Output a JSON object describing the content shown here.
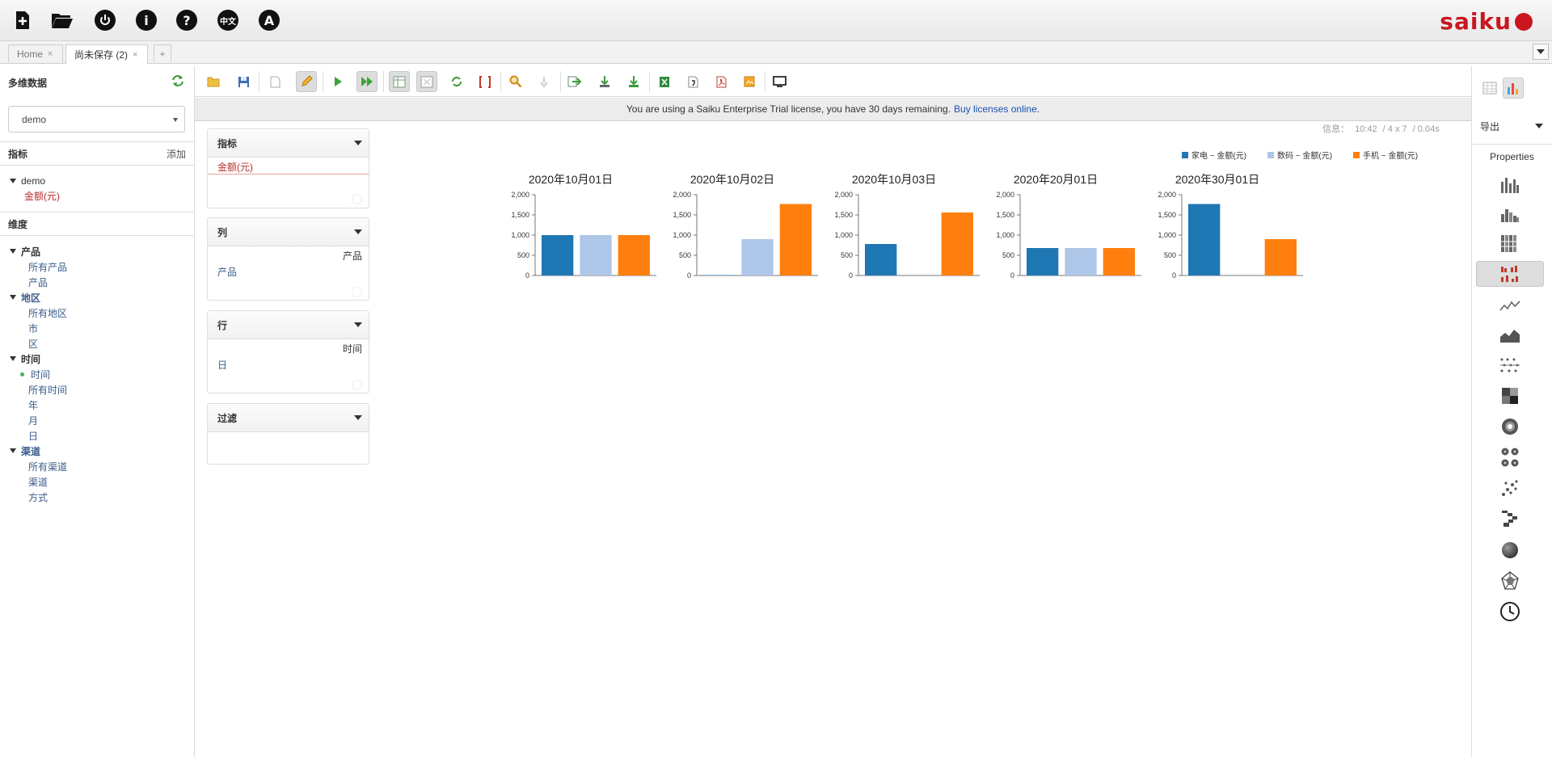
{
  "app": {
    "logo_text": "saiku",
    "brand_color": "#c9161f",
    "top_icons": [
      "new-query-icon",
      "open-query-icon",
      "logout-icon",
      "about-icon",
      "help-icon",
      "language-icon",
      "admin-icon"
    ],
    "language_glyph": "中文",
    "admin_glyph": "A",
    "help_glyph": "?",
    "about_glyph": "i"
  },
  "tabs": [
    {
      "label": "Home",
      "close": "×"
    },
    {
      "label": "尚未保存 (2)",
      "close": "×"
    }
  ],
  "tab_add": "+",
  "left": {
    "title": "多维数据",
    "cube": "demo",
    "measures_header": "指标",
    "measures_add": "添加",
    "measure_cube": "demo",
    "measure_item": "金额(元)",
    "dimensions_header": "维度",
    "dim_product": "产品",
    "dim_product_items": [
      "所有产品",
      "产品"
    ],
    "dim_region": "地区",
    "dim_region_items": [
      "所有地区",
      "市",
      "区"
    ],
    "dim_time": "时间",
    "dim_time_hier": "时间",
    "dim_time_items": [
      "所有时间",
      "年",
      "月",
      "日"
    ],
    "dim_channel": "渠道",
    "dim_channel_items": [
      "所有渠道",
      "渠道",
      "方式"
    ]
  },
  "banner": {
    "text": "You are using a Saiku Enterprise Trial license, you have 30 days remaining.",
    "link": "Buy licenses online."
  },
  "info": {
    "label": "信息：",
    "time": "10:42",
    "size": "/  4 x 7",
    "duration": "/  0.04s"
  },
  "drops": {
    "measures": {
      "title": "指标",
      "item": "金额(元)"
    },
    "columns": {
      "title": "列",
      "hier": "产品",
      "item": "产品"
    },
    "rows": {
      "title": "行",
      "hier": "时间",
      "item": "日"
    },
    "filter": {
      "title": "过滤"
    }
  },
  "right": {
    "export_label": "导出",
    "properties_label": "Properties",
    "chart_types": [
      "bar-chart-icon",
      "stacked-bar-icon",
      "stacked-100-bar-icon",
      "multiple-bar-icon",
      "line-chart-icon",
      "area-chart-icon",
      "dot-chart-icon",
      "heatgrid-icon",
      "sunburst-icon",
      "multi-pie-icon",
      "scatter-icon",
      "waterfall-icon",
      "bubble-icon",
      "radar-icon",
      "clock-icon"
    ]
  },
  "chart_data": {
    "type": "bar",
    "layout": "small-multiples",
    "legend_position": "top-right",
    "series": [
      {
        "name": "家电 ~ 金额(元)",
        "color": "#1f77b4"
      },
      {
        "name": "数码 ~ 金额(元)",
        "color": "#aec7e8"
      },
      {
        "name": "手机 ~ 金额(元)",
        "color": "#ff7f0e"
      }
    ],
    "ylim": [
      0,
      2000
    ],
    "yticks": [
      "0",
      "500",
      "1,000",
      "1,500",
      "2,000"
    ],
    "panels": [
      {
        "title": "2020年10月01日",
        "values": [
          1000,
          1000,
          1000
        ]
      },
      {
        "title": "2020年10月02日",
        "values": [
          10,
          900,
          1770
        ]
      },
      {
        "title": "2020年10月03日",
        "values": [
          780,
          0,
          1560
        ]
      },
      {
        "title": "2020年20月01日",
        "values": [
          680,
          680,
          680
        ]
      },
      {
        "title": "2020年30月01日",
        "values": [
          1770,
          0,
          900
        ]
      }
    ]
  }
}
